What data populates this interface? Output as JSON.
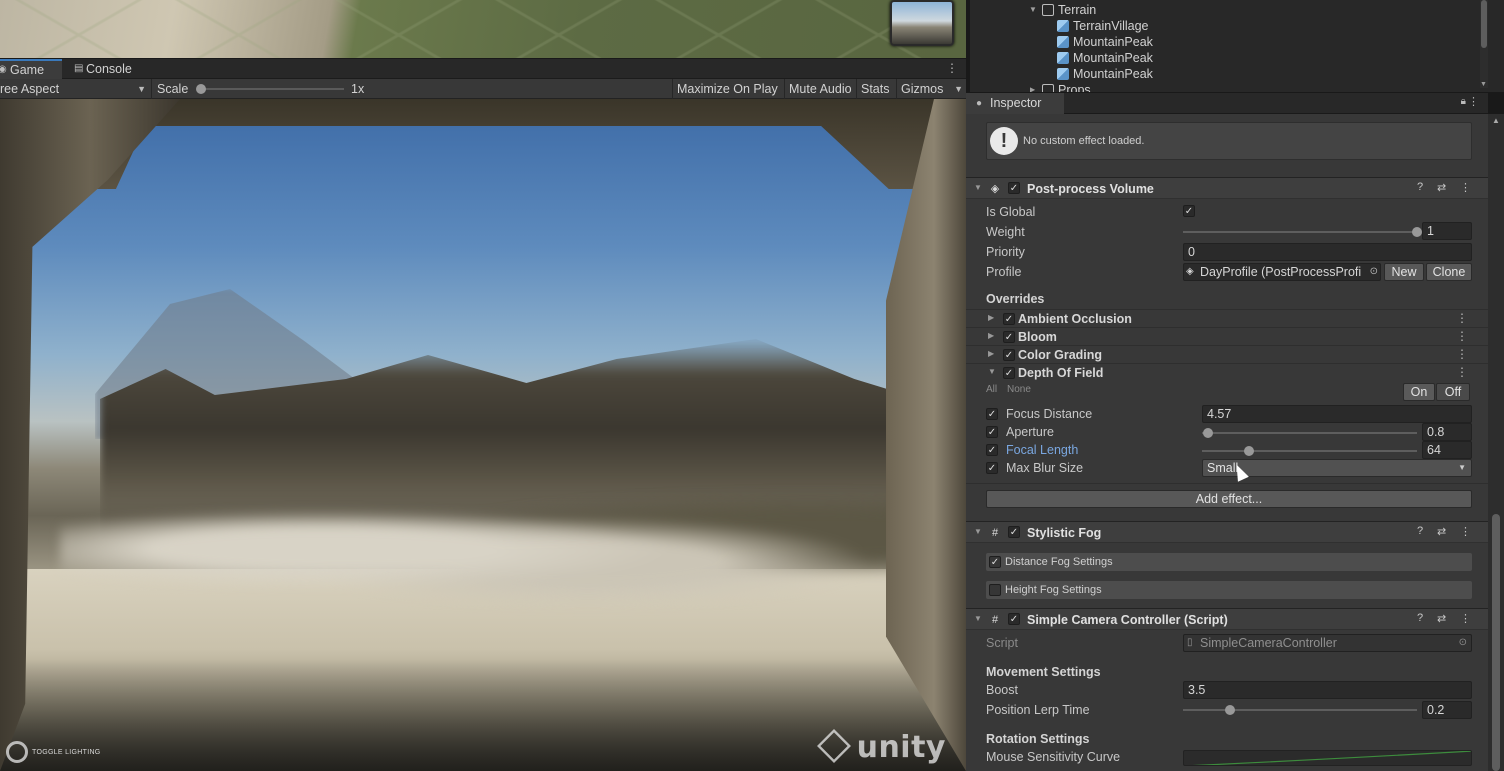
{
  "game_tabs": {
    "game": "Game",
    "console": "Console"
  },
  "game_toolbar": {
    "aspect": "ree Aspect",
    "scale_label": "Scale",
    "scale_value": "1x",
    "maximize": "Maximize On Play",
    "mute": "Mute Audio",
    "stats": "Stats",
    "gizmos": "Gizmos"
  },
  "game_overlay": {
    "toggle_lighting": "TOGGLE LIGHTING",
    "watermark": "unity"
  },
  "hierarchy": {
    "items": [
      {
        "label": "Terrain"
      },
      {
        "label": "TerrainVillage"
      },
      {
        "label": "MountainPeak"
      },
      {
        "label": "MountainPeak"
      },
      {
        "label": "MountainPeak"
      },
      {
        "label": "Props"
      }
    ]
  },
  "inspector": {
    "tab": "Inspector",
    "help_message": "No custom effect loaded.",
    "post_volume": {
      "title": "Post-process Volume",
      "is_global_label": "Is Global",
      "is_global": true,
      "weight_label": "Weight",
      "weight_value": "1",
      "weight_fraction": 1.0,
      "priority_label": "Priority",
      "priority_value": "0",
      "profile_label": "Profile",
      "profile_value": "DayProfile (PostProcessProfi",
      "new_label": "New",
      "clone_label": "Clone",
      "overrides_label": "Overrides",
      "overrides": [
        {
          "name": "Ambient Occlusion",
          "expanded": false
        },
        {
          "name": "Bloom",
          "expanded": false
        },
        {
          "name": "Color Grading",
          "expanded": false
        },
        {
          "name": "Depth Of Field",
          "expanded": true
        }
      ],
      "all_label": "All",
      "none_label": "None",
      "on_label": "On",
      "off_label": "Off",
      "dof": {
        "focus_distance_label": "Focus Distance",
        "focus_distance_value": "4.57",
        "aperture_label": "Aperture",
        "aperture_value": "0.8",
        "aperture_fraction": 0.03,
        "focal_length_label": "Focal Length",
        "focal_length_value": "64",
        "focal_length_fraction": 0.22,
        "max_blur_label": "Max Blur Size",
        "max_blur_value": "Small"
      },
      "add_effect": "Add effect..."
    },
    "stylistic_fog": {
      "title": "Stylistic Fog",
      "distance_label": "Distance Fog Settings",
      "distance_checked": true,
      "height_label": "Height Fog Settings",
      "height_checked": false
    },
    "camera_controller": {
      "title": "Simple Camera Controller (Script)",
      "script_label": "Script",
      "script_value": "SimpleCameraController",
      "movement_header": "Movement Settings",
      "boost_label": "Boost",
      "boost_value": "3.5",
      "lerp_label": "Position Lerp Time",
      "lerp_value": "0.2",
      "lerp_fraction": 0.2,
      "rotation_header": "Rotation Settings",
      "mouse_curve_label": "Mouse Sensitivity Curve"
    }
  },
  "colors": {
    "accent_blue": "#3a79bb",
    "label_blue": "#7aa7e0",
    "panel": "#383838"
  }
}
